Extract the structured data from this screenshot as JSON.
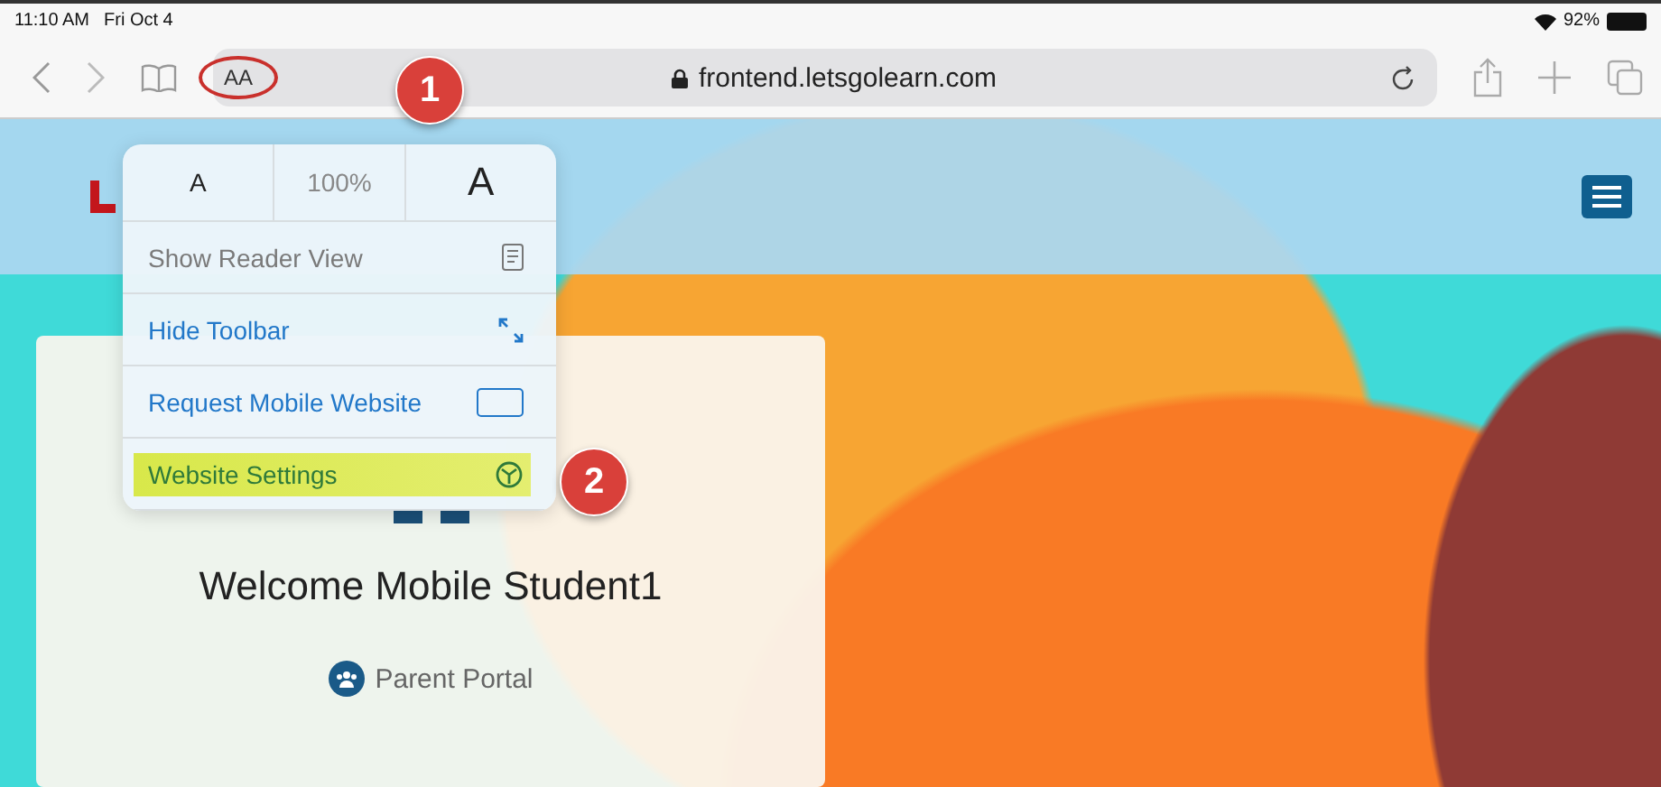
{
  "status_bar": {
    "time": "11:10 AM",
    "date": "Fri Oct 4",
    "battery": "92%"
  },
  "toolbar": {
    "text_size_button": "AA",
    "address": "frontend.letsgolearn.com"
  },
  "text_menu": {
    "font_smaller": "A",
    "zoom": "100%",
    "font_larger": "A",
    "items": [
      {
        "label": "Show Reader View",
        "kind": "reader",
        "disabled": true,
        "highlighted": false
      },
      {
        "label": "Hide Toolbar",
        "kind": "resize",
        "disabled": false,
        "highlighted": false
      },
      {
        "label": "Request Mobile Website",
        "kind": "device",
        "disabled": false,
        "highlighted": false
      },
      {
        "label": "Website Settings",
        "kind": "settings",
        "disabled": false,
        "highlighted": true
      }
    ]
  },
  "callouts": [
    "1",
    "2"
  ],
  "card": {
    "welcome": "Welcome Mobile Student1",
    "link": "Parent Portal"
  }
}
